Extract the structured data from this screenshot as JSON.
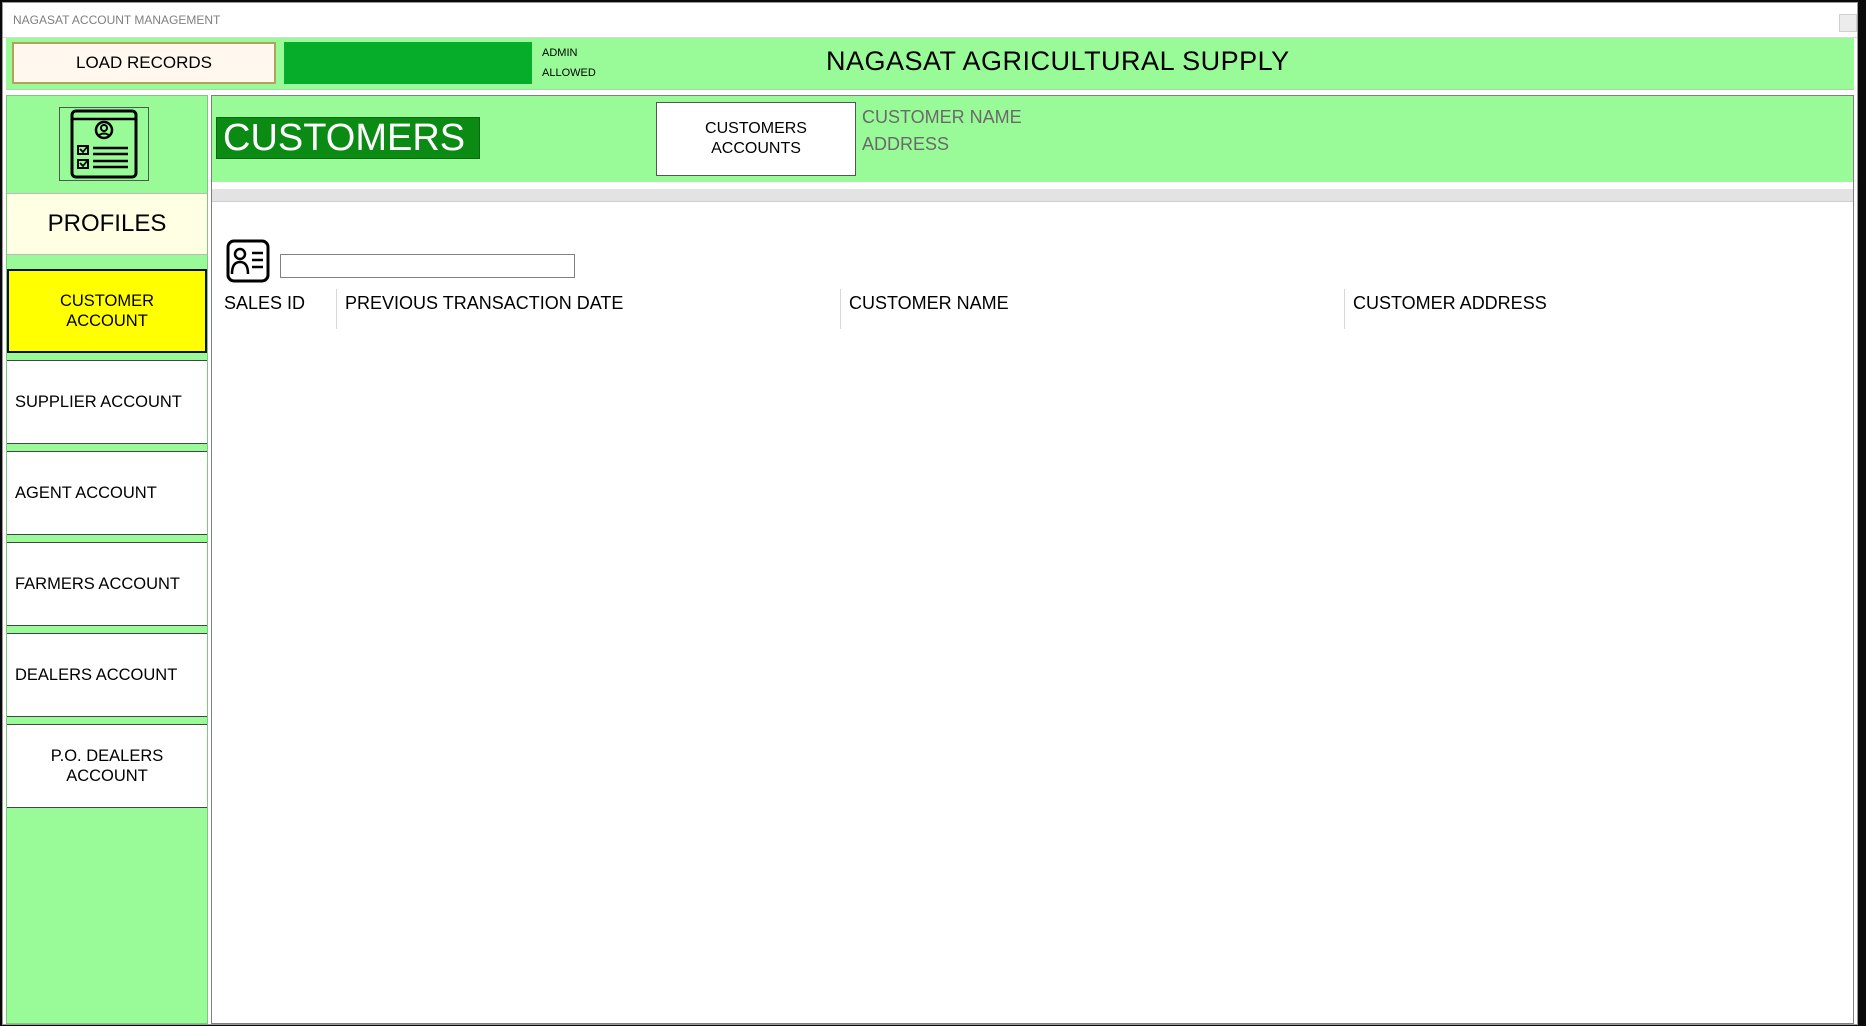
{
  "window": {
    "title": "NAGASAT ACCOUNT MANAGEMENT"
  },
  "topbar": {
    "load_button": "LOAD RECORDS",
    "user_role": "ADMIN",
    "access_status": "ALLOWED",
    "company_name": "NAGASAT AGRICULTURAL SUPPLY",
    "status_color": "#05ad2a"
  },
  "sidebar": {
    "logo_icon": "profile-document-icon",
    "heading": "PROFILES",
    "items": [
      {
        "label": "CUSTOMER ACCOUNT",
        "active": true
      },
      {
        "label": "SUPPLIER ACCOUNT",
        "active": false
      },
      {
        "label": "AGENT ACCOUNT",
        "active": false
      },
      {
        "label": "FARMERS ACCOUNT",
        "active": false
      },
      {
        "label": "DEALERS ACCOUNT",
        "active": false
      },
      {
        "label": "P.O. DEALERS ACCOUNT",
        "active": false
      }
    ]
  },
  "main": {
    "title": "CUSTOMERS",
    "accounts_button": "CUSTOMERS ACCOUNTS",
    "customer_name_label": "CUSTOMER NAME",
    "address_label": "ADDRESS",
    "search": {
      "value": "",
      "icon": "contact-card-icon"
    },
    "columns": [
      "SALES ID",
      "PREVIOUS TRANSACTION DATE",
      "CUSTOMER NAME",
      "CUSTOMER ADDRESS"
    ],
    "rows": []
  },
  "colors": {
    "background_green": "#99fb98",
    "title_green": "#0b8a14",
    "active_yellow": "#ffff00"
  }
}
